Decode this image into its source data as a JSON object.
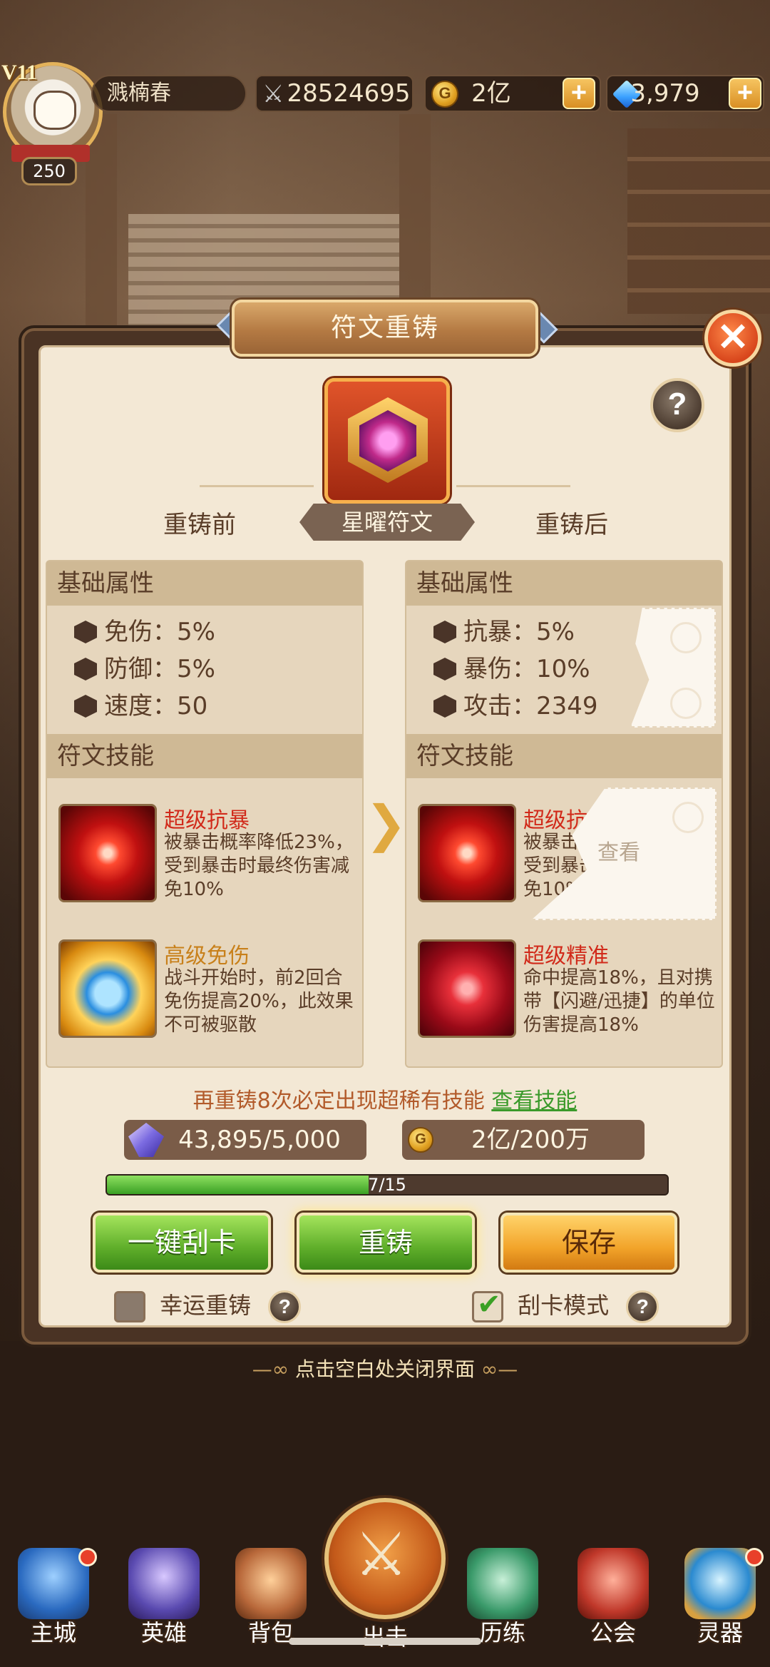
{
  "header": {
    "vip": "V11",
    "level": "250",
    "player_name": "溅楠春",
    "power": "28524695",
    "gold": "2亿",
    "gems": "3,979"
  },
  "dialog": {
    "title": "符文重铸",
    "rune_name": "星曜符文",
    "label_before": "重铸前",
    "label_after": "重铸后",
    "left": {
      "base_title": "基础属性",
      "attrs": [
        {
          "name": "免伤：5%"
        },
        {
          "name": "防御：5%"
        },
        {
          "name": "速度：50"
        }
      ],
      "skills_title": "符文技能",
      "skills": [
        {
          "title": "超级抗暴",
          "desc": "被暴击概率降低23%，受到暴击时最终伤害减免10%"
        },
        {
          "title": "高级免伤",
          "desc": "战斗开始时，前2回合免伤提高20%，此效果不可被驱散"
        }
      ]
    },
    "right": {
      "base_title": "基础属性",
      "attrs": [
        {
          "name": "抗暴：5%"
        },
        {
          "name": "暴伤：10%"
        },
        {
          "name": "攻击：2349"
        }
      ],
      "skills_title": "符文技能",
      "skills": [
        {
          "title": "超级抗暴",
          "desc": "被暴击概率降低23%，受到暴击时最终伤害减免10%"
        },
        {
          "title": "超级精准",
          "desc": "命中提高18%，且对携带【闪避/迅捷】的单位伤害提高18%"
        }
      ],
      "scratch_view": "查看"
    },
    "hint_text": "再重铸8次必定出现超稀有技能",
    "hint_link": "查看技能",
    "cost_crystal": "43,895/5,000",
    "cost_gold": "2亿/200万",
    "progress_text": "7/15",
    "progress_value": 0.4667,
    "buttons": {
      "scratch_all": "一键刮卡",
      "reforge": "重铸",
      "save": "保存"
    },
    "options": {
      "lucky_reforge": "幸运重铸",
      "lucky_checked": false,
      "scratch_mode": "刮卡模式",
      "scratch_checked": true
    },
    "close_hint": "点击空白处关闭界面"
  },
  "nav": {
    "items": [
      {
        "label": "主城"
      },
      {
        "label": "英雄"
      },
      {
        "label": "背包"
      },
      {
        "label": "出击"
      },
      {
        "label": "历练"
      },
      {
        "label": "公会"
      },
      {
        "label": "灵器"
      }
    ]
  },
  "icons": {
    "power": "crossed-swords-icon",
    "gold": "gold-coin-icon",
    "gems": "diamond-icon",
    "close": "close-icon",
    "help": "question-icon"
  },
  "colors": {
    "accent_green": "#5fae2a",
    "accent_orange": "#f2a42a",
    "skill_red_text": "#d12a1a",
    "skill_gold_text": "#c8801a",
    "link_green": "#3a9a2a"
  }
}
